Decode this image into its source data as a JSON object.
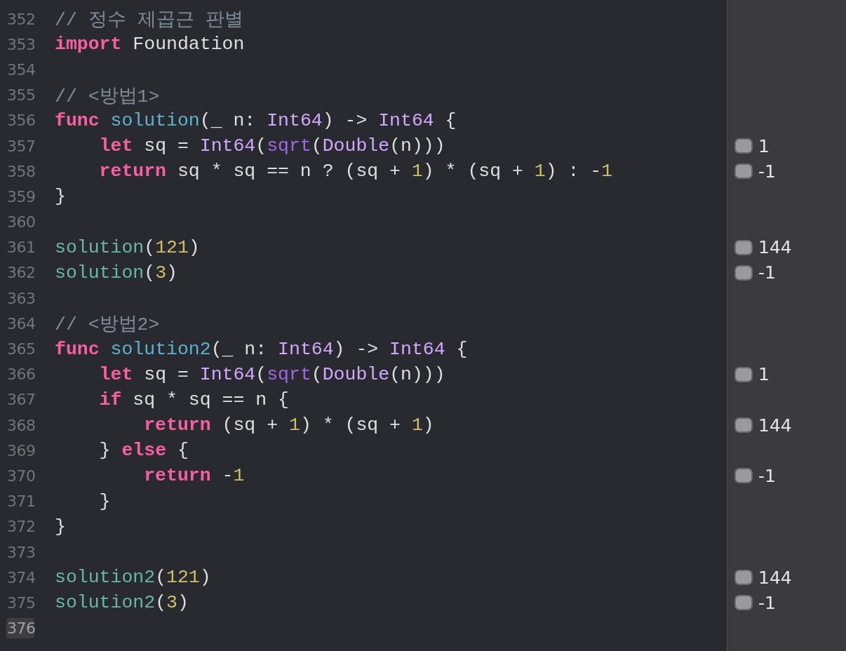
{
  "editor": {
    "lines": [
      {
        "number": "352",
        "selected": false,
        "tokens": [
          {
            "kind": "comment",
            "text": "// 정수 제곱근 판별"
          }
        ]
      },
      {
        "number": "353",
        "selected": false,
        "tokens": [
          {
            "kind": "keyword",
            "text": "import"
          },
          {
            "kind": "plain",
            "text": " Foundation"
          }
        ]
      },
      {
        "number": "354",
        "selected": false
      },
      {
        "number": "355",
        "selected": false,
        "tokens": [
          {
            "kind": "comment",
            "text": "// <방법1>"
          }
        ]
      },
      {
        "number": "356",
        "selected": false,
        "tokens": [
          {
            "kind": "keyword",
            "text": "func"
          },
          {
            "kind": "decl",
            "text": " solution"
          },
          {
            "kind": "plain",
            "text": "(_ n: "
          },
          {
            "kind": "type",
            "text": "Int64"
          },
          {
            "kind": "plain",
            "text": ") -> "
          },
          {
            "kind": "type",
            "text": "Int64"
          },
          {
            "kind": "plain",
            "text": " {"
          }
        ]
      },
      {
        "number": "357",
        "selected": false,
        "tokens": [
          {
            "kind": "keyword",
            "text": "    let"
          },
          {
            "kind": "plain",
            "text": " sq = "
          },
          {
            "kind": "type",
            "text": "Int64"
          },
          {
            "kind": "plain",
            "text": "("
          },
          {
            "kind": "function",
            "text": "sqrt"
          },
          {
            "kind": "plain",
            "text": "("
          },
          {
            "kind": "type",
            "text": "Double"
          },
          {
            "kind": "plain",
            "text": "(n)))"
          }
        ],
        "result": "1"
      },
      {
        "number": "358",
        "selected": false,
        "tokens": [
          {
            "kind": "keyword",
            "text": "    return"
          },
          {
            "kind": "plain",
            "text": " sq * sq == n ? (sq + "
          },
          {
            "kind": "number",
            "text": "1"
          },
          {
            "kind": "plain",
            "text": ") * (sq + "
          },
          {
            "kind": "number",
            "text": "1"
          },
          {
            "kind": "plain",
            "text": ") : -"
          },
          {
            "kind": "number",
            "text": "1"
          }
        ],
        "result": "-1"
      },
      {
        "number": "359",
        "selected": false,
        "tokens": [
          {
            "kind": "plain",
            "text": "}"
          }
        ]
      },
      {
        "number": "360",
        "selected": false
      },
      {
        "number": "361",
        "selected": false,
        "tokens": [
          {
            "kind": "call",
            "text": "solution"
          },
          {
            "kind": "plain",
            "text": "("
          },
          {
            "kind": "number",
            "text": "121"
          },
          {
            "kind": "plain",
            "text": ")"
          }
        ],
        "result": "144"
      },
      {
        "number": "362",
        "selected": false,
        "tokens": [
          {
            "kind": "call",
            "text": "solution"
          },
          {
            "kind": "plain",
            "text": "("
          },
          {
            "kind": "number",
            "text": "3"
          },
          {
            "kind": "plain",
            "text": ")"
          }
        ],
        "result": "-1"
      },
      {
        "number": "363",
        "selected": false
      },
      {
        "number": "364",
        "selected": false,
        "tokens": [
          {
            "kind": "comment",
            "text": "// <방법2>"
          }
        ]
      },
      {
        "number": "365",
        "selected": false,
        "tokens": [
          {
            "kind": "keyword",
            "text": "func"
          },
          {
            "kind": "decl",
            "text": " solution2"
          },
          {
            "kind": "plain",
            "text": "(_ n: "
          },
          {
            "kind": "type",
            "text": "Int64"
          },
          {
            "kind": "plain",
            "text": ") -> "
          },
          {
            "kind": "type",
            "text": "Int64"
          },
          {
            "kind": "plain",
            "text": " {"
          }
        ]
      },
      {
        "number": "366",
        "selected": false,
        "tokens": [
          {
            "kind": "keyword",
            "text": "    let"
          },
          {
            "kind": "plain",
            "text": " sq = "
          },
          {
            "kind": "type",
            "text": "Int64"
          },
          {
            "kind": "plain",
            "text": "("
          },
          {
            "kind": "function",
            "text": "sqrt"
          },
          {
            "kind": "plain",
            "text": "("
          },
          {
            "kind": "type",
            "text": "Double"
          },
          {
            "kind": "plain",
            "text": "(n)))"
          }
        ],
        "result": "1"
      },
      {
        "number": "367",
        "selected": false,
        "tokens": [
          {
            "kind": "keyword",
            "text": "    if"
          },
          {
            "kind": "plain",
            "text": " sq * sq == n {"
          }
        ]
      },
      {
        "number": "368",
        "selected": false,
        "tokens": [
          {
            "kind": "keyword",
            "text": "        return"
          },
          {
            "kind": "plain",
            "text": " (sq + "
          },
          {
            "kind": "number",
            "text": "1"
          },
          {
            "kind": "plain",
            "text": ") * (sq + "
          },
          {
            "kind": "number",
            "text": "1"
          },
          {
            "kind": "plain",
            "text": ")"
          }
        ],
        "result": "144"
      },
      {
        "number": "369",
        "selected": false,
        "tokens": [
          {
            "kind": "plain",
            "text": "    } "
          },
          {
            "kind": "keyword",
            "text": "else"
          },
          {
            "kind": "plain",
            "text": " {"
          }
        ]
      },
      {
        "number": "370",
        "selected": false,
        "tokens": [
          {
            "kind": "keyword",
            "text": "        return"
          },
          {
            "kind": "plain",
            "text": " -"
          },
          {
            "kind": "number",
            "text": "1"
          }
        ],
        "result": "-1"
      },
      {
        "number": "371",
        "selected": false,
        "tokens": [
          {
            "kind": "plain",
            "text": "    }"
          }
        ]
      },
      {
        "number": "372",
        "selected": false,
        "tokens": [
          {
            "kind": "plain",
            "text": "}"
          }
        ]
      },
      {
        "number": "373",
        "selected": false
      },
      {
        "number": "374",
        "selected": false,
        "tokens": [
          {
            "kind": "call",
            "text": "solution2"
          },
          {
            "kind": "plain",
            "text": "("
          },
          {
            "kind": "number",
            "text": "121"
          },
          {
            "kind": "plain",
            "text": ")"
          }
        ],
        "result": "144"
      },
      {
        "number": "375",
        "selected": false,
        "tokens": [
          {
            "kind": "call",
            "text": "solution2"
          },
          {
            "kind": "plain",
            "text": "("
          },
          {
            "kind": "number",
            "text": "3"
          },
          {
            "kind": "plain",
            "text": ")"
          }
        ],
        "result": "-1"
      },
      {
        "number": "376",
        "selected": true
      }
    ]
  }
}
